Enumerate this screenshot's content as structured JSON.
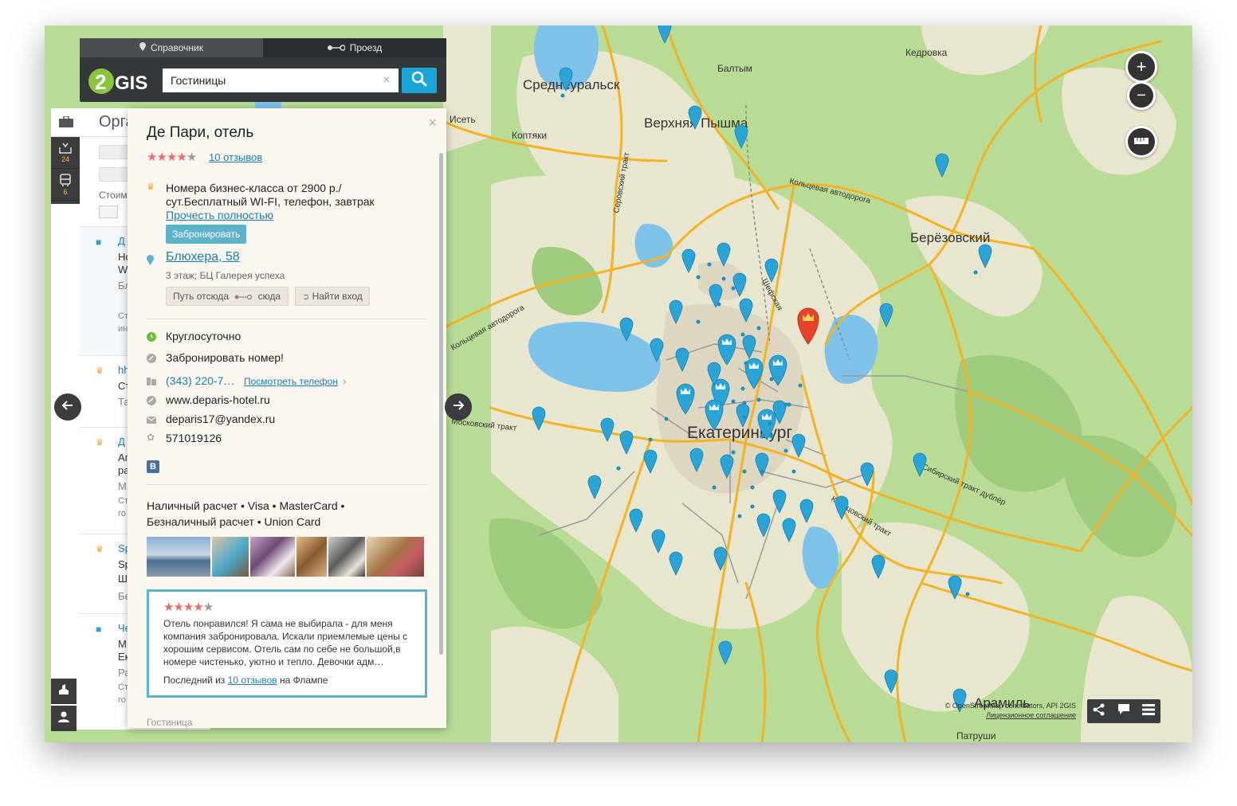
{
  "header": {
    "tabs": [
      {
        "label": "Справочник",
        "icon": "pin-icon",
        "active": true
      },
      {
        "label": "Проезд",
        "icon": "route-icon",
        "active": false
      }
    ],
    "logo": "2GIS",
    "search_value": "Гостиницы",
    "clear_glyph": "×"
  },
  "list": {
    "title": "Орга",
    "rail": [
      {
        "icon": "inbox-icon",
        "count": "24"
      },
      {
        "icon": "bus-icon",
        "count": "6"
      }
    ],
    "filter_label": "Стоим",
    "items": [
      {
        "t1": "Д",
        "t2": "Но",
        "t3": "W",
        "t4": "Бл",
        "t5": "Ст",
        "t6": "ин"
      },
      {
        "t1": "hh",
        "t2": "Ст",
        "t3": "Та"
      },
      {
        "t1": "Д",
        "t2": "Ап",
        "t3": "ра",
        "t4": "М",
        "t5": "Ст",
        "t6": "го"
      },
      {
        "t1": "Sp",
        "t2": "Sp",
        "t3": "Ш",
        "t4": "Бе"
      },
      {
        "t1": "Че",
        "t2": "М",
        "t3": "Ек",
        "t4": "Ра",
        "t5": "Ст",
        "t6": "го"
      }
    ]
  },
  "card": {
    "title": "Де Пари, отель",
    "rating": 4,
    "reviews_link": "10 отзывов",
    "promo_line1": "Номера бизнес-класса от 2900 р./",
    "promo_line2": "сут.Бесплатный WI-FI, телефон, завтрак",
    "read_more": "Прочесть полностью",
    "book_button": "Забронировать",
    "address": "Блюхера, 58",
    "address_detail": "3 этаж; БЦ Галерея успеха",
    "route_from": "Путь отсюда",
    "route_to": "сюда",
    "find_entrance": "Найти вход",
    "hours": "Круглосуточно",
    "book_room": "Забронировать номер!",
    "phone": "(343) 220-7…",
    "show_phone": "Посмотреть телефон",
    "website": "www.deparis-hotel.ru",
    "email": "deparis17@yandex.ru",
    "icq": "571019126",
    "vk": "B",
    "payments_line1": "Наличный расчет • Visa • MasterCard •",
    "payments_line2": "Безналичный расчет • Union Card",
    "review": {
      "rating": 4,
      "text": "Отель понравился! Я сама не выбирала - для меня компания забронировала. Искали приемлемые цены с хорошим сервисом. Отель сам по себе не большой,в номере чистенько, уютно и тепло. Девочки адм…",
      "foot_prefix": "Последний из",
      "foot_link": "10 отзывов",
      "foot_suffix": "на Флампе"
    },
    "category": "Гостиница",
    "close_glyph": "×"
  },
  "map": {
    "places": {
      "sredneuralsk": "Среднеуральск",
      "verkhnyaya_pyshma": "Верхняя Пышма",
      "balтym": "Балтым",
      "kedrovka": "Кедровка",
      "iset": "Исеть",
      "koptyaki": "Коптяки",
      "berezovsky": "Берёзовский",
      "ekaterinburg": "Екатеринбург",
      "aramil": "Арамиль",
      "patrushi": "Патруши"
    },
    "roads": {
      "serovsky": "Серовский тракт",
      "ring1": "Кольцевая автодорога",
      "ring2": "Кольцевая автодорога",
      "shefskaya": "Шефская",
      "moskovsky": "Московский тракт",
      "sibirsky": "Сибирский тракт дублёр",
      "koltsovsky": "Кольцовский тракт"
    },
    "credits_line1": "© OpenStreetMap contributors, API 2GIS",
    "credits_line2": "Лицензионное соглашение",
    "zoom_in": "+",
    "zoom_out": "−"
  },
  "colors": {
    "marker_blue": "#2aa3d6",
    "marker_selected": "#e8432a",
    "accent": "#1aa7d8",
    "forest": "#a9d38a",
    "road": "#f3b324"
  }
}
